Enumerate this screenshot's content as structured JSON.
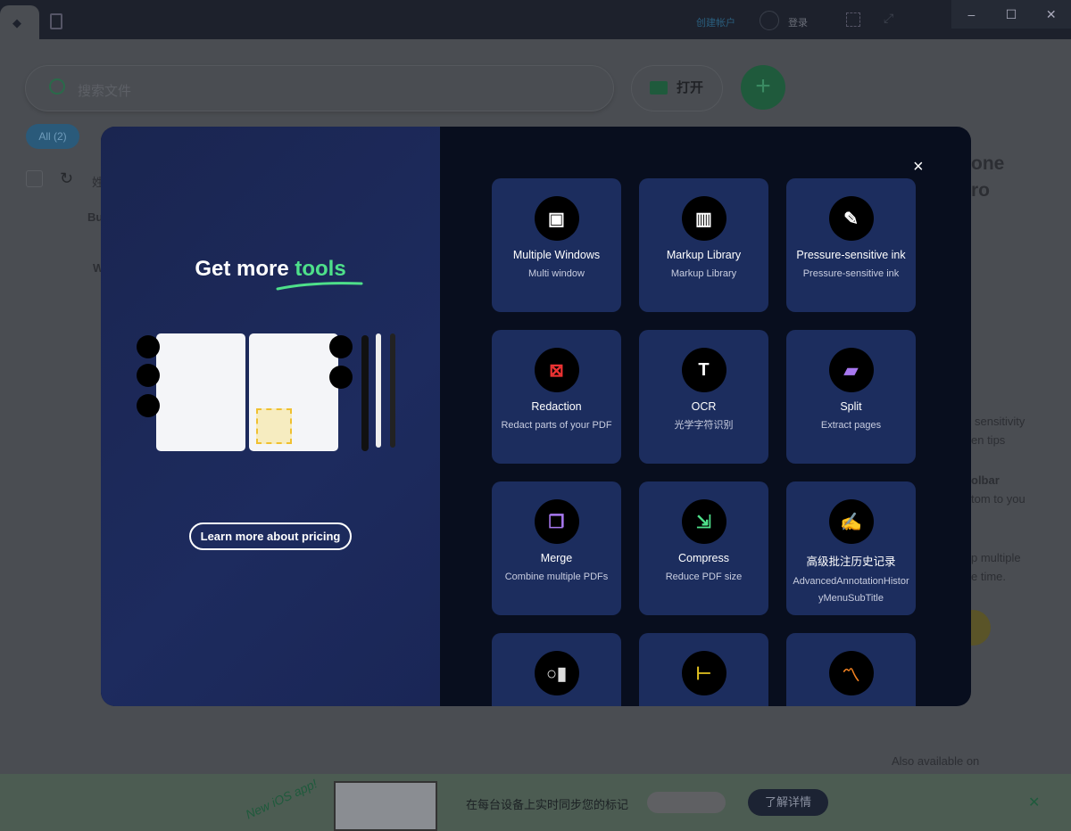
{
  "titlebar": {
    "create_account": "创建帐户",
    "login": "登录",
    "window_controls": [
      "minimize",
      "maximize",
      "close"
    ]
  },
  "search": {
    "placeholder": "搜索文件"
  },
  "toolbar": {
    "open_label": "打开",
    "add_label": "+"
  },
  "filters": {
    "all_chip": "All (2)"
  },
  "list": {
    "header_partial": "姓",
    "rows": [
      {
        "name_partial": "Bu"
      },
      {
        "name_partial": "W"
      }
    ]
  },
  "promo_partial": {
    "title_lines": [
      "one",
      "ro"
    ],
    "lines": [
      "sensitivity",
      "en tips",
      "olbar",
      "tom to you",
      "p multiple",
      "e time."
    ],
    "also_available": "Also available on"
  },
  "banner": {
    "handwritten": "New iOS app!",
    "message": "在每台设备上实时同步您的标记",
    "learn_more": "了解详情"
  },
  "modal": {
    "title_prefix": "Get more ",
    "title_highlight": "tools",
    "pricing_button": "Learn more about pricing",
    "close": "×",
    "accent_color": "#4ee08a",
    "tools": [
      {
        "title": "Multiple Windows",
        "subtitle": "Multi window",
        "icon": "window-plus-icon"
      },
      {
        "title": "Markup Library",
        "subtitle": "Markup Library",
        "icon": "library-books-icon"
      },
      {
        "title": "Pressure-sensitive ink",
        "subtitle": "Pressure-sensitive ink",
        "icon": "pen-icon"
      },
      {
        "title": "Redaction",
        "subtitle": "Redact parts of your PDF",
        "icon": "redact-icon"
      },
      {
        "title": "OCR",
        "subtitle": "光学字符识别",
        "icon": "ocr-text-icon"
      },
      {
        "title": "Split",
        "subtitle": "Extract pages",
        "icon": "split-icon"
      },
      {
        "title": "Merge",
        "subtitle": "Combine multiple PDFs",
        "icon": "merge-icon"
      },
      {
        "title": "Compress",
        "subtitle": "Reduce PDF size",
        "icon": "compress-icon"
      },
      {
        "title": "高级批注历史记录",
        "subtitle": "AdvancedAnnotationHistoryMenuSubTitle",
        "icon": "annotation-history-icon"
      },
      {
        "title": "",
        "subtitle": "",
        "icon": "eraser-divider-icon"
      },
      {
        "title": "",
        "subtitle": "",
        "icon": "ruler-measure-icon"
      },
      {
        "title": "",
        "subtitle": "",
        "icon": "chart-ruler-icon"
      }
    ]
  }
}
